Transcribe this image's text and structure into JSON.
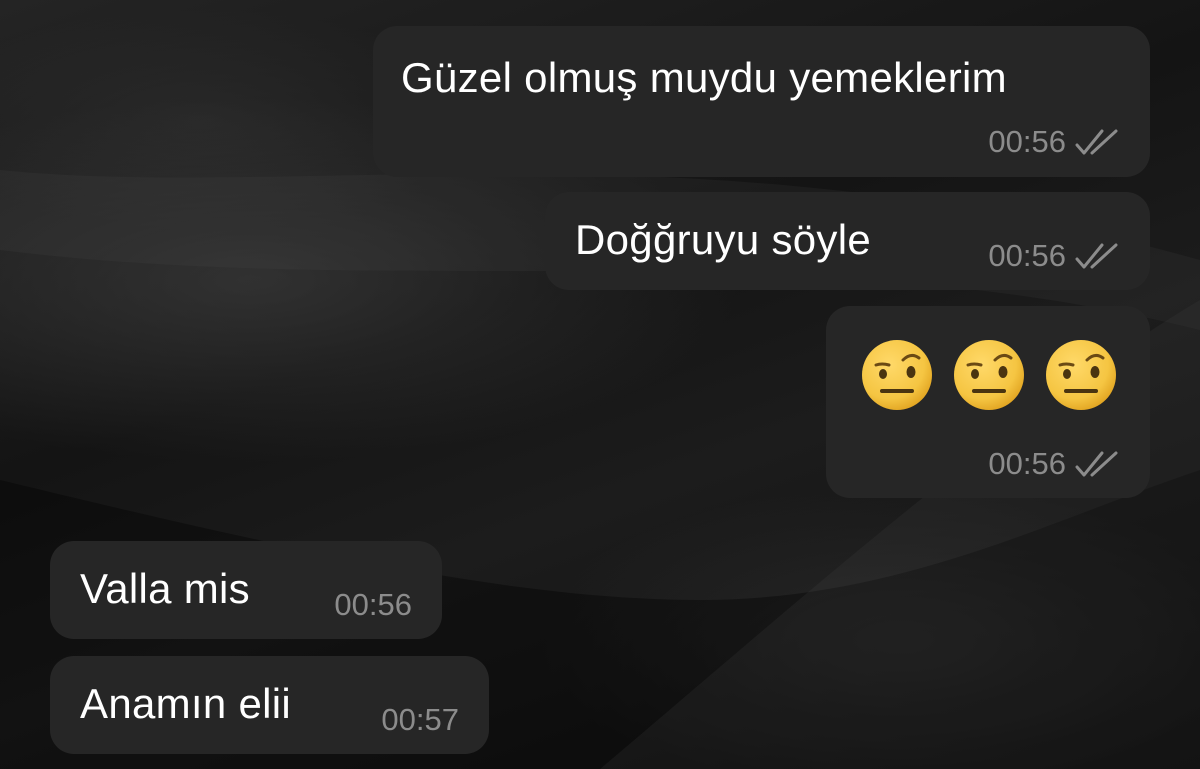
{
  "messages": [
    {
      "direction": "outgoing",
      "text": "Güzel olmuş muydu yemeklerim",
      "time": "00:56",
      "status": "read-double-check-icon"
    },
    {
      "direction": "outgoing",
      "text": "Doğğruyu söyle",
      "time": "00:56",
      "status": "read-double-check-icon"
    },
    {
      "direction": "outgoing",
      "emoji": [
        "face-with-raised-eyebrow",
        "face-with-raised-eyebrow",
        "face-with-raised-eyebrow"
      ],
      "time": "00:56",
      "status": "read-double-check-icon"
    },
    {
      "direction": "incoming",
      "text": "Valla mis",
      "time": "00:56"
    },
    {
      "direction": "incoming",
      "text": "Anamın elii",
      "time": "00:57"
    }
  ],
  "colors": {
    "bubble": "#262626",
    "text": "#ffffff",
    "meta": "#8c8c8c",
    "emoji_face": "#f5c542"
  }
}
